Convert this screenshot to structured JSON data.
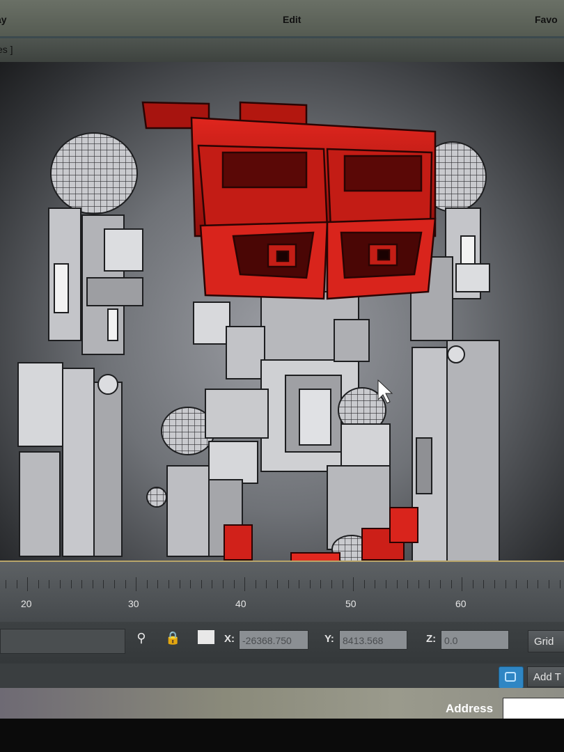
{
  "menubar": {
    "items": [
      "ay",
      "Edit",
      "Favo"
    ]
  },
  "subbar": {
    "tab_label": "es ]"
  },
  "viewport": {
    "cursor": "arrow-cursor-icon"
  },
  "timeline": {
    "labels": [
      "20",
      "30",
      "40",
      "50",
      "60"
    ]
  },
  "status": {
    "icons": [
      "lightbulb-icon",
      "lock-icon",
      "selection-icon"
    ],
    "x_label": "X:",
    "x_value": "-26368.750",
    "y_label": "Y:",
    "y_value": "8413.568",
    "z_label": "Z:",
    "z_value": "0.0",
    "grid_label": "Grid",
    "add_label": "Add T"
  },
  "taskbar": {
    "address_label": "Address",
    "address_value": ""
  },
  "colors": {
    "selected_mesh": "#d4201a",
    "mesh": "#b8b9bd",
    "accent_key": "#2f86c4"
  }
}
